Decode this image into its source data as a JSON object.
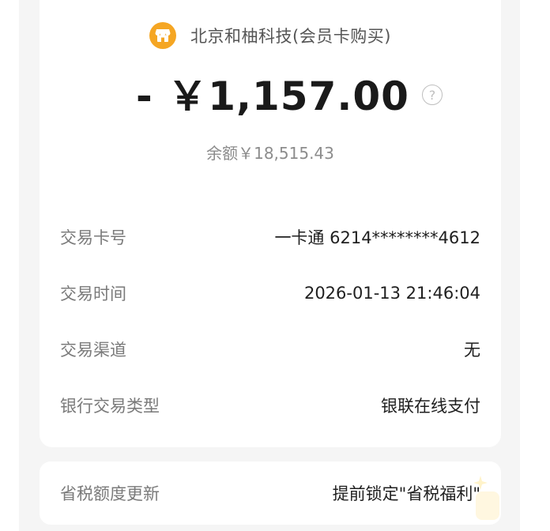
{
  "merchant": {
    "name": "北京和柚科技(会员卡购买)",
    "icon": "store-icon",
    "icon_color": "#f5a623"
  },
  "amount": {
    "display": "- ￥1,157.00",
    "help_icon": "question-circle-icon"
  },
  "balance": {
    "text": "余额￥18,515.43"
  },
  "details": [
    {
      "label": "交易卡号",
      "value": "一卡通 6214********4612"
    },
    {
      "label": "交易时间",
      "value": "2026-01-13 21:46:04"
    },
    {
      "label": "交易渠道",
      "value": "无"
    },
    {
      "label": "银行交易类型",
      "value": "银联在线支付"
    }
  ],
  "tax": {
    "label": "省税额度更新",
    "value": "提前锁定\"省税福利\""
  },
  "colors": {
    "accent": "#f5a623",
    "label_gray": "#7a7a7a",
    "background": "#f5f5f5"
  }
}
